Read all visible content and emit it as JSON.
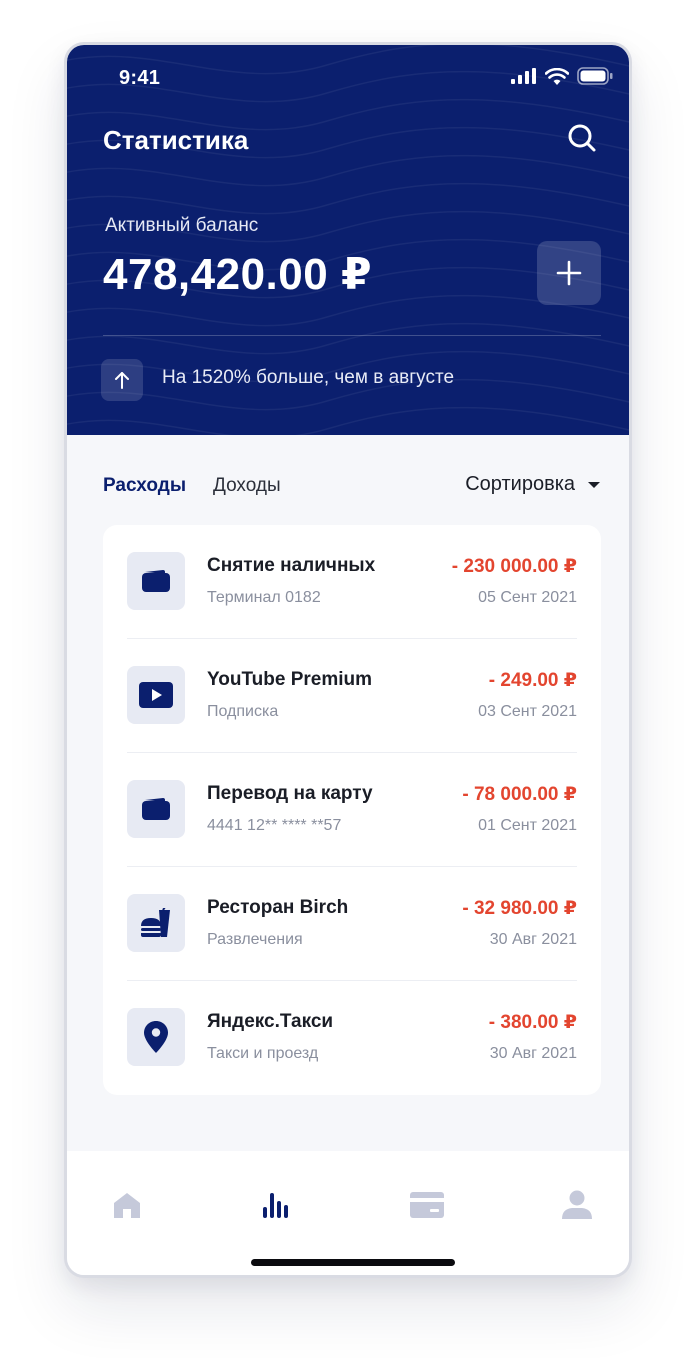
{
  "status_bar": {
    "time": "9:41"
  },
  "header": {
    "title": "Статистика",
    "balance_label": "Активный баланс",
    "balance_value": "478,420.00 ₽",
    "trend_text": "На 1520% больше, чем в августе"
  },
  "tabs": {
    "expenses": "Расходы",
    "income": "Доходы",
    "sort": "Сортировка"
  },
  "transactions": [
    {
      "icon": "wallet-icon",
      "title": "Снятие наличных",
      "subtitle": "Терминал 0182",
      "amount": "- 230 000.00 ₽",
      "date": "05 Сент 2021"
    },
    {
      "icon": "play-icon",
      "title": "YouTube Premium",
      "subtitle": "Подписка",
      "amount": "- 249.00 ₽",
      "date": "03 Сент 2021"
    },
    {
      "icon": "wallet-icon",
      "title": "Перевод на карту",
      "subtitle": "4441 12** **** **57",
      "amount": "- 78 000.00 ₽",
      "date": "01 Сент 2021"
    },
    {
      "icon": "fastfood-icon",
      "title": "Ресторан Birch",
      "subtitle": "Развлечения",
      "amount": "- 32 980.00 ₽",
      "date": "30 Авг 2021"
    },
    {
      "icon": "location-pin-icon",
      "title": "Яндекс.Такси",
      "subtitle": "Такси и проезд",
      "amount": "- 380.00 ₽",
      "date": "30 Авг 2021"
    }
  ],
  "bottom_nav": [
    {
      "icon": "home-icon",
      "active": false
    },
    {
      "icon": "statistics-icon",
      "active": true
    },
    {
      "icon": "card-icon",
      "active": false
    },
    {
      "icon": "profile-icon",
      "active": false
    }
  ],
  "colors": {
    "primary": "#0b1f6e",
    "negative": "#e3452f",
    "icon_bg": "#e7eaf3",
    "nav_inactive": "#c5c9da"
  }
}
